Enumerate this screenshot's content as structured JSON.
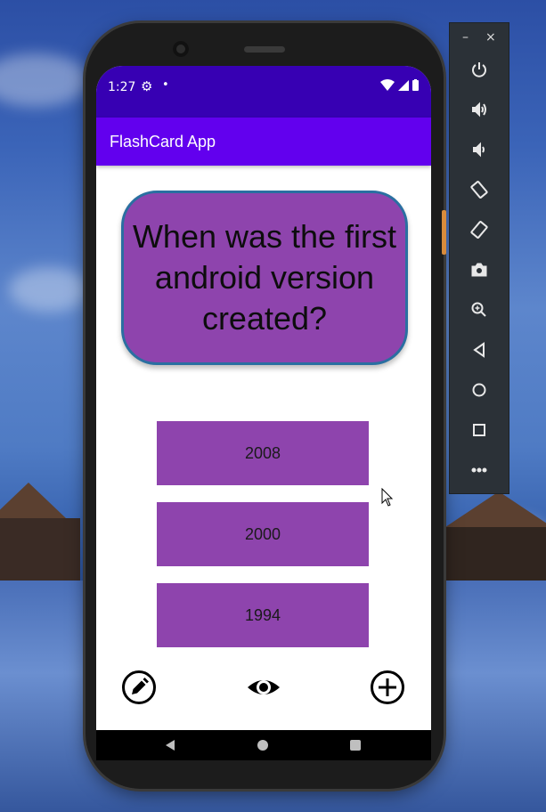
{
  "status_bar": {
    "time": "1:27"
  },
  "app_bar": {
    "title": "FlashCard App"
  },
  "flashcard": {
    "question": "When was the first android version created?",
    "answers": [
      "2008",
      "2000",
      "1994"
    ]
  },
  "colors": {
    "status_bar": "#3700b3",
    "app_bar": "#6200ee",
    "card": "#8e44ad",
    "card_border": "#2a6fa1"
  },
  "bottom_actions": [
    "edit-icon",
    "eye-icon",
    "add-icon"
  ],
  "emulator_toolbar": {
    "window_controls": [
      "–",
      "×"
    ],
    "buttons": [
      "power-icon",
      "volume-up-icon",
      "volume-down-icon",
      "rotate-left-icon",
      "rotate-right-icon",
      "camera-icon",
      "zoom-icon",
      "back-icon",
      "home-icon",
      "overview-icon",
      "more-icon"
    ]
  }
}
